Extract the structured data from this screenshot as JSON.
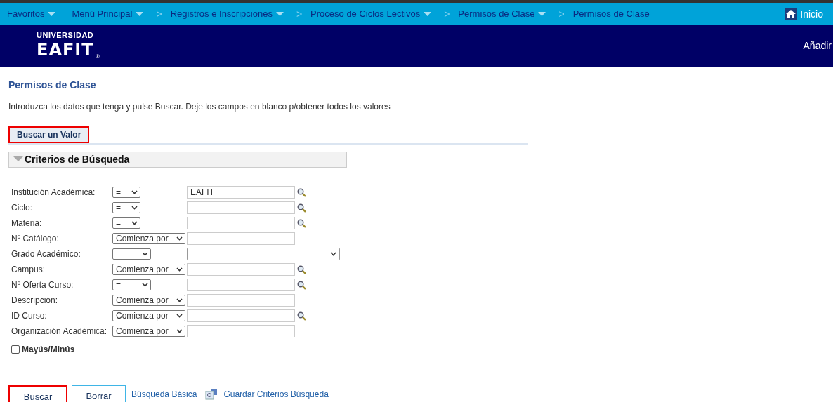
{
  "nav": {
    "items": [
      {
        "label": "Favoritos",
        "dropdown": true,
        "divider": false
      },
      {
        "label": "Menú Principal",
        "dropdown": true,
        "divider": true
      },
      {
        "label": "Registros e Inscripciones",
        "dropdown": true,
        "divider": false,
        "separator": ">"
      },
      {
        "label": "Proceso de Ciclos Lectivos",
        "dropdown": true,
        "divider": false,
        "separator": ">"
      },
      {
        "label": "Permisos de Clase",
        "dropdown": true,
        "divider": false,
        "separator": ">"
      },
      {
        "label": "Permisos de Clase",
        "dropdown": false,
        "divider": false,
        "separator": ">"
      }
    ],
    "home": "Inicio"
  },
  "banner": {
    "logo_top": "UNIVERSIDAD",
    "logo_main": "EAFIT",
    "logo_mark": "®",
    "action": "Añadir"
  },
  "page": {
    "title": "Permisos de Clase",
    "instructions": "Introduzca los datos que tenga y pulse Buscar. Deje los campos en blanco p/obtener todos los valores"
  },
  "tab": {
    "label": "Buscar un Valor",
    "selected": true,
    "highlighted": true
  },
  "section": {
    "title": "Criterios de Búsqueda",
    "expanded": true
  },
  "criteria": [
    {
      "label": "Institución Académica:",
      "operator": {
        "value": "=",
        "kind": "short"
      },
      "kind": "text",
      "value": "EAFIT",
      "lookup": true
    },
    {
      "label": "Ciclo:",
      "operator": {
        "value": "=",
        "kind": "short"
      },
      "kind": "text",
      "lookup": true
    },
    {
      "label": "Materia:",
      "operator": {
        "value": "=",
        "kind": "short"
      },
      "kind": "text",
      "lookup": true
    },
    {
      "label": "Nº Catálogo:",
      "operator": {
        "value": "Comienza por",
        "kind": "wide"
      },
      "kind": "text",
      "lookup": false
    },
    {
      "label": "Grado Académico:",
      "operator": {
        "value": "=",
        "kind": "medium"
      },
      "kind": "select",
      "lookup": false
    },
    {
      "label": "Campus:",
      "operator": {
        "value": "Comienza por",
        "kind": "wide"
      },
      "kind": "text",
      "lookup": true
    },
    {
      "label": "Nº Oferta Curso:",
      "operator": {
        "value": "=",
        "kind": "medium"
      },
      "kind": "text",
      "lookup": true
    },
    {
      "label": "Descripción:",
      "operator": {
        "value": "Comienza por",
        "kind": "wide"
      },
      "kind": "text",
      "lookup": false
    },
    {
      "label": "ID Curso:",
      "operator": {
        "value": "Comienza por",
        "kind": "wide"
      },
      "kind": "text",
      "lookup": true
    },
    {
      "label": "Organización Académica:",
      "operator": {
        "value": "Comienza por",
        "kind": "wide"
      },
      "kind": "text",
      "lookup": false
    }
  ],
  "case_sensitive": {
    "label": "Mayús/Minús",
    "checked": false
  },
  "buttons": [
    {
      "label": "Buscar",
      "highlighted": true
    },
    {
      "label": "Borrar",
      "highlighted": false
    }
  ],
  "links": [
    {
      "label": "Búsqueda Básica",
      "icon": false
    },
    {
      "label": "Guardar Criterios Búsqueda",
      "icon": true
    }
  ]
}
